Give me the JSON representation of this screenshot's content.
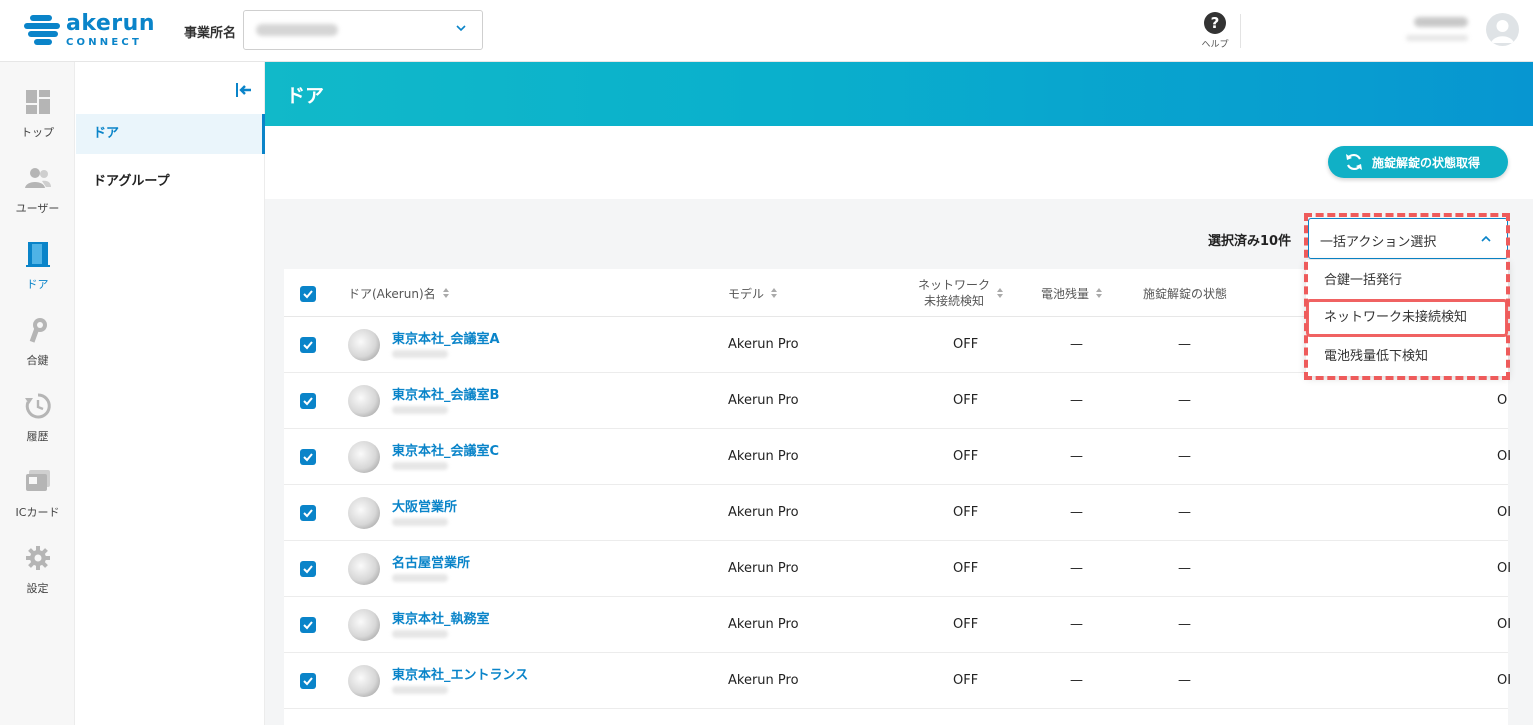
{
  "header": {
    "logo_primary": "akerun",
    "logo_secondary": "CONNECT",
    "office_label": "事業所名",
    "help_label": "ヘルプ",
    "help_glyph": "?"
  },
  "nav": {
    "items": [
      {
        "label": "トップ",
        "icon": "dashboard-icon"
      },
      {
        "label": "ユーザー",
        "icon": "users-icon"
      },
      {
        "label": "ドア",
        "icon": "door-icon",
        "active": true
      },
      {
        "label": "合鍵",
        "icon": "key-icon"
      },
      {
        "label": "履歴",
        "icon": "history-icon"
      },
      {
        "label": "ICカード",
        "icon": "ic-card-icon"
      },
      {
        "label": "設定",
        "icon": "gear-icon"
      }
    ]
  },
  "subnav": {
    "items": [
      {
        "label": "ドア",
        "active": true
      },
      {
        "label": "ドアグループ"
      }
    ]
  },
  "page": {
    "title": "ドア",
    "status_button": "施錠解錠の状態取得",
    "selected_count": "選択済み10件",
    "bulk_action": {
      "placeholder": "一括アクション選択",
      "options": [
        "合鍵一括発行",
        "ネットワーク未接続検知",
        "電池残量低下検知"
      ],
      "highlighted_index": 1
    }
  },
  "table": {
    "headers": {
      "name": "ドア(Akerun)名",
      "model": "モデル",
      "network_line1": "ネットワーク",
      "network_line2": "未接続検知",
      "battery": "電池残量",
      "lock_state": "施錠解錠の状態"
    },
    "rows": [
      {
        "name": "東京本社_会議室A",
        "model": "Akerun Pro",
        "network": "OFF",
        "battery": "—",
        "lock_state": "—",
        "trailing": ""
      },
      {
        "name": "東京本社_会議室B",
        "model": "Akerun Pro",
        "network": "OFF",
        "battery": "—",
        "lock_state": "—",
        "trailing": "O"
      },
      {
        "name": "東京本社_会議室C",
        "model": "Akerun Pro",
        "network": "OFF",
        "battery": "—",
        "lock_state": "—",
        "trailing": "OI"
      },
      {
        "name": "大阪営業所",
        "model": "Akerun Pro",
        "network": "OFF",
        "battery": "—",
        "lock_state": "—",
        "trailing": "OI"
      },
      {
        "name": "名古屋営業所",
        "model": "Akerun Pro",
        "network": "OFF",
        "battery": "—",
        "lock_state": "—",
        "trailing": "OI"
      },
      {
        "name": "東京本社_執務室",
        "model": "Akerun Pro",
        "network": "OFF",
        "battery": "—",
        "lock_state": "—",
        "trailing": "OI"
      },
      {
        "name": "東京本社_エントランス",
        "model": "Akerun Pro",
        "network": "OFF",
        "battery": "—",
        "lock_state": "—",
        "trailing": "OI"
      }
    ]
  },
  "colors": {
    "brand": "#0a84c9",
    "banner_start": "#11b9c9",
    "banner_end": "#0796d1",
    "annotation": "#ee5b5b"
  }
}
